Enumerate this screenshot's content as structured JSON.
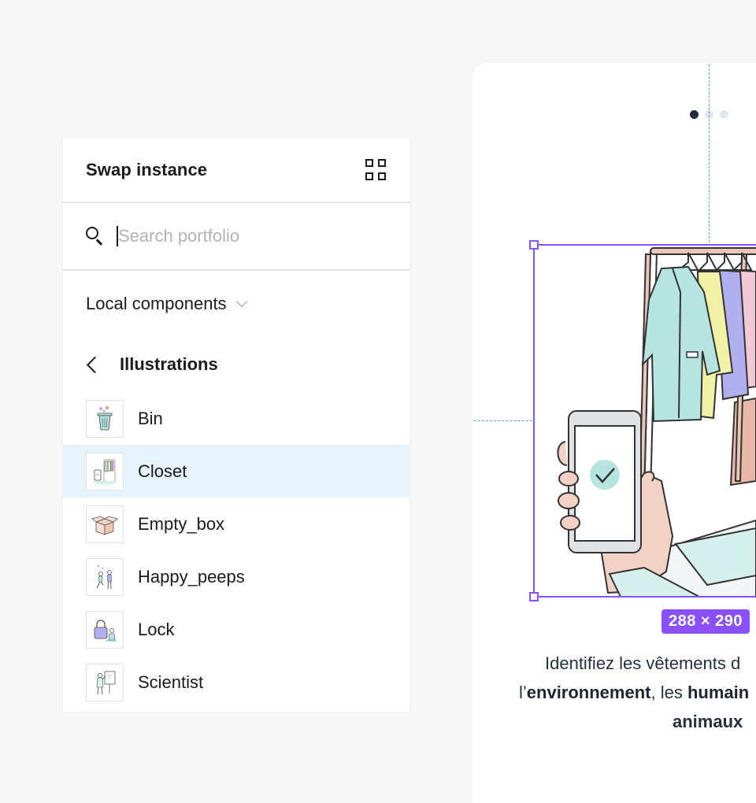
{
  "panel": {
    "title": "Swap instance",
    "grid_icon": "grid-view-icon",
    "search": {
      "placeholder": "Search portfolio",
      "value": ""
    },
    "library": {
      "label": "Local components"
    },
    "folder": {
      "label": "Illustrations"
    },
    "items": [
      {
        "label": "Bin",
        "selected": false
      },
      {
        "label": "Closet",
        "selected": true
      },
      {
        "label": "Empty_box",
        "selected": false
      },
      {
        "label": "Happy_peeps",
        "selected": false
      },
      {
        "label": "Lock",
        "selected": false
      },
      {
        "label": "Scientist",
        "selected": false
      }
    ]
  },
  "canvas": {
    "pagination_dots": 3,
    "active_dot": 0,
    "size_badge": "288 × 290",
    "caption": {
      "line1": "Identifiez les vêtements d",
      "line2_pre": "l’",
      "line2_bold1": "environnement",
      "line2_mid": ", les ",
      "line2_bold2": "humain",
      "line3": "animaux"
    }
  },
  "colors": {
    "selection": "#8a4fff",
    "guide": "#4aa6e8",
    "selected_row": "#e6f3fc"
  }
}
